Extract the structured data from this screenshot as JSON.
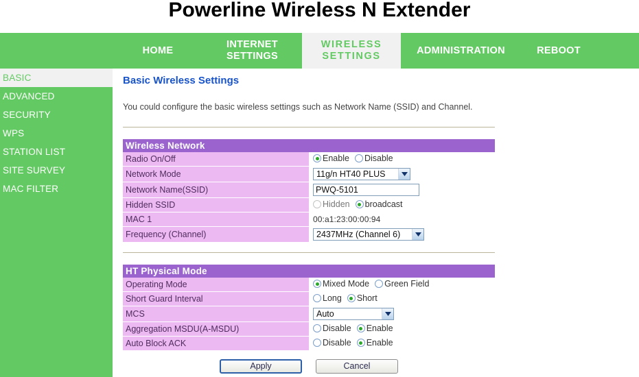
{
  "app": {
    "title": "Powerline Wireless N Extender"
  },
  "nav": {
    "items": [
      {
        "label": "HOME",
        "active": false
      },
      {
        "label": "INTERNET\nSETTINGS",
        "active": false
      },
      {
        "label": "WIRELESS\nSETTINGS",
        "active": true
      },
      {
        "label": "ADMINISTRATION",
        "active": false
      },
      {
        "label": "REBOOT",
        "active": false
      }
    ]
  },
  "sidebar": {
    "items": [
      {
        "label": "BASIC",
        "active": true
      },
      {
        "label": "ADVANCED",
        "active": false
      },
      {
        "label": "SECURITY",
        "active": false
      },
      {
        "label": "WPS",
        "active": false
      },
      {
        "label": "STATION LIST",
        "active": false
      },
      {
        "label": "SITE SURVEY",
        "active": false
      },
      {
        "label": "MAC FILTER",
        "active": false
      }
    ]
  },
  "main": {
    "heading": "Basic Wireless Settings",
    "description": "You could configure the basic wireless settings such as Network Name (SSID) and Channel.",
    "sections": [
      {
        "title": "Wireless Network",
        "rows": [
          {
            "label": "Radio On/Off",
            "type": "radio",
            "options": [
              {
                "label": "Enable",
                "selected": true
              },
              {
                "label": "Disable",
                "selected": false
              }
            ]
          },
          {
            "label": "Network Mode",
            "type": "select",
            "value": "11g/n HT40 PLUS"
          },
          {
            "label": "Network Name(SSID)",
            "type": "text",
            "value": "PWQ-5101",
            "placeholder": ""
          },
          {
            "label": "Hidden SSID",
            "type": "radio",
            "options": [
              {
                "label": "Hidden",
                "selected": false,
                "dim": true
              },
              {
                "label": "broadcast",
                "selected": true
              }
            ]
          },
          {
            "label": "MAC 1",
            "type": "static",
            "value": "00:a1:23:00:00:94"
          },
          {
            "label": "Frequency (Channel)",
            "type": "select",
            "value": "2437MHz (Channel 6)"
          }
        ]
      },
      {
        "title": "HT Physical Mode",
        "rows": [
          {
            "label": "Operating Mode",
            "type": "radio",
            "options": [
              {
                "label": "Mixed Mode",
                "selected": true
              },
              {
                "label": "Green Field",
                "selected": false
              }
            ]
          },
          {
            "label": "Short Guard Interval",
            "type": "radio",
            "options": [
              {
                "label": "Long",
                "selected": false
              },
              {
                "label": "Short",
                "selected": true
              }
            ]
          },
          {
            "label": "MCS",
            "type": "select",
            "value": "Auto"
          },
          {
            "label": "Aggregation MSDU(A-MSDU)",
            "type": "radio",
            "options": [
              {
                "label": "Disable",
                "selected": false
              },
              {
                "label": "Enable",
                "selected": true
              }
            ]
          },
          {
            "label": "Auto Block ACK",
            "type": "radio",
            "options": [
              {
                "label": "Disable",
                "selected": false
              },
              {
                "label": "Enable",
                "selected": true
              }
            ]
          }
        ]
      }
    ],
    "buttons": {
      "apply": "Apply",
      "cancel": "Cancel"
    }
  },
  "icons": {
    "dropdown": "chevron-down-icon"
  },
  "colors": {
    "nav_green": "#63ca63",
    "section_purple": "#9a63ce",
    "label_pink": "#edb9f2",
    "heading_blue": "#1853c8",
    "radio_dot_green": "#2aa82a"
  }
}
